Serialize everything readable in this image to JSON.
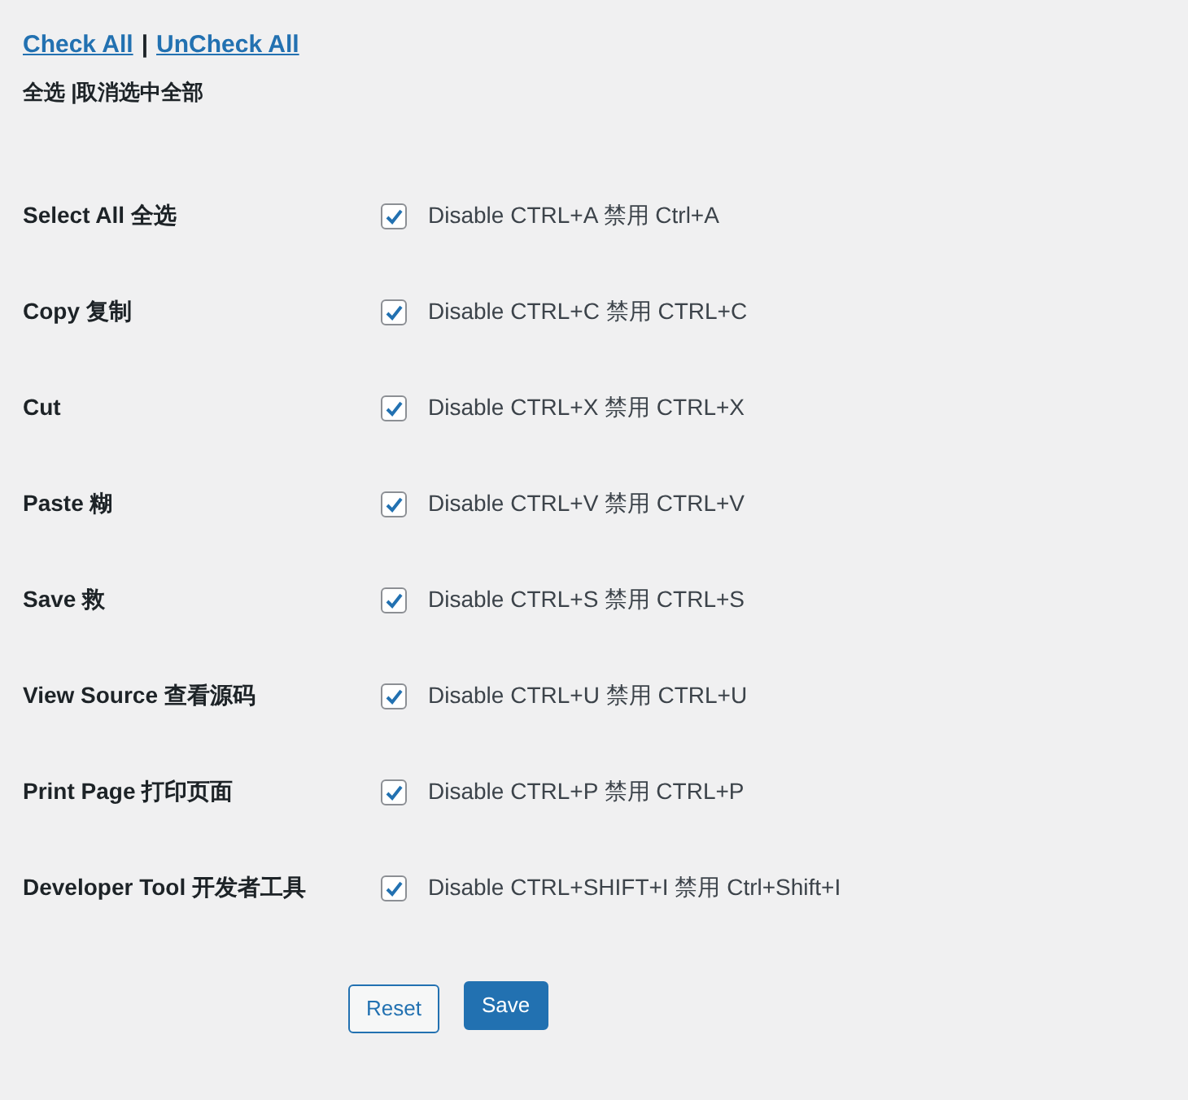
{
  "links": [
    {
      "label": "Check All"
    },
    {
      "label": "UnCheck All"
    }
  ],
  "separator": "|",
  "subtitle": "全选 |取消选中全部",
  "options": [
    {
      "label": "Select All 全选",
      "checked": true,
      "description": "Disable CTRL+A 禁用 Ctrl+A"
    },
    {
      "label": "Copy 复制",
      "checked": true,
      "description": "Disable CTRL+C 禁用 CTRL+C"
    },
    {
      "label": "Cut",
      "checked": true,
      "description": "Disable CTRL+X 禁用 CTRL+X"
    },
    {
      "label": "Paste 糊",
      "checked": true,
      "description": "Disable CTRL+V 禁用 CTRL+V"
    },
    {
      "label": "Save 救",
      "checked": true,
      "description": "Disable CTRL+S 禁用 CTRL+S"
    },
    {
      "label": "View Source 查看源码",
      "checked": true,
      "description": "Disable CTRL+U 禁用 CTRL+U"
    },
    {
      "label": "Print Page 打印页面",
      "checked": true,
      "description": "Disable CTRL+P 禁用 CTRL+P"
    },
    {
      "label": "Developer Tool 开发者工具",
      "checked": true,
      "description": "Disable CTRL+SHIFT+I 禁用 Ctrl+Shift+I"
    }
  ],
  "buttons": [
    {
      "label": "Reset",
      "kind": "secondary"
    },
    {
      "label": "Save",
      "kind": "primary"
    }
  ]
}
